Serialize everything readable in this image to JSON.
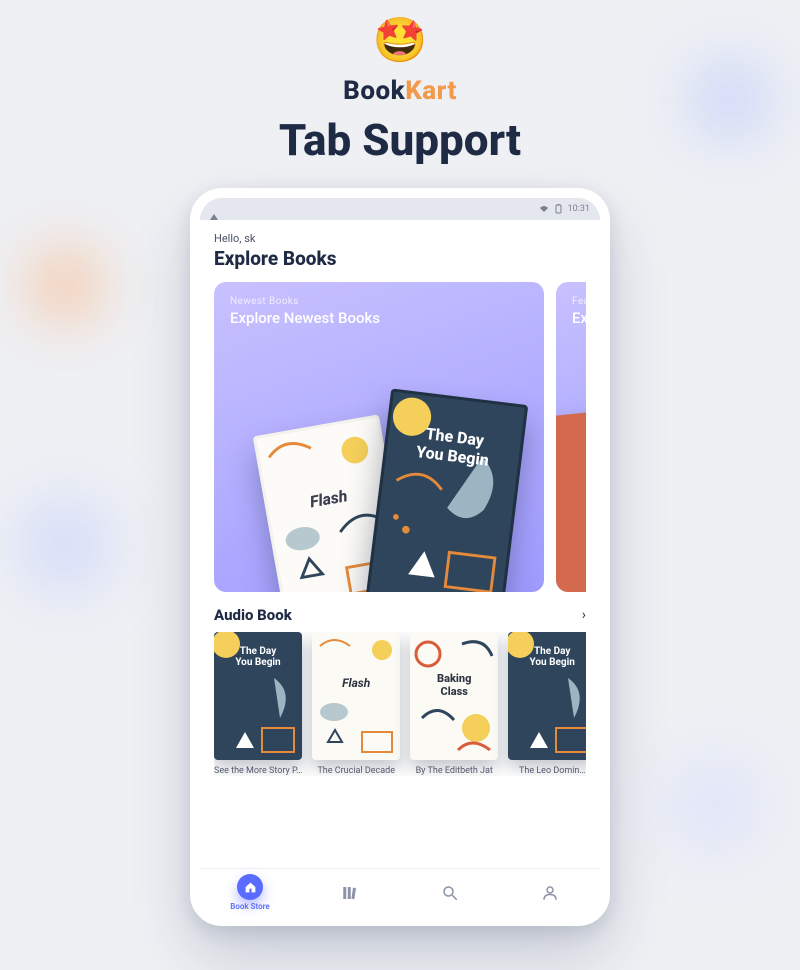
{
  "hero": {
    "emoji": "🤩",
    "brand_a": "Book",
    "brand_b": "Kart",
    "headline": "Tab Support"
  },
  "statusbar": {
    "time": "10:31"
  },
  "home": {
    "greeting": "Hello, sk",
    "title": "Explore Books"
  },
  "featured": [
    {
      "subtitle": "Newest Books",
      "title": "Explore Newest Books",
      "book_a": "Flash",
      "book_b_line1": "The Day",
      "book_b_line2": "You Begin"
    },
    {
      "subtitle": "Featu",
      "title": "Explo"
    }
  ],
  "section": {
    "title": "Audio Book"
  },
  "covers": [
    {
      "title_a": "The Day",
      "title_b": "You Begin",
      "caption": "See the More Story P…"
    },
    {
      "title": "Flash",
      "caption": "The Crucial Decade"
    },
    {
      "title_a": "Baking",
      "title_b": "Class",
      "caption": "By The Editbeth Jat"
    },
    {
      "title_a": "The Day",
      "title_b": "You Begin",
      "caption": "The Leo Domin…"
    }
  ],
  "nav": {
    "active_label": "Book Store"
  }
}
